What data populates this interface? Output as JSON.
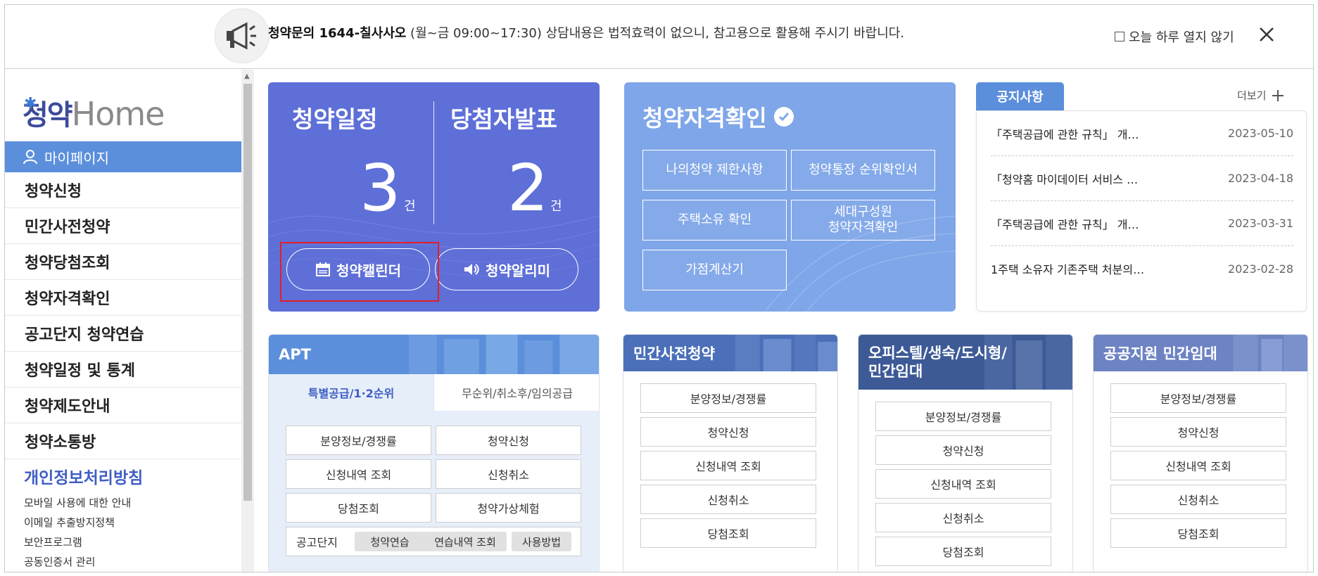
{
  "notice_bar": {
    "inquiry_bold": "청약문의 1644-칠사사오",
    "hours": " (월~금 09:00~17:30)",
    "message": " 상담내용은 법적효력이 없으니, 참고용으로 활용해 주시기 바랍니다.",
    "dont_show_today": "오늘 하루 열지 않기"
  },
  "sidebar": {
    "logo_korean": "청약",
    "logo_english": "Home",
    "mypage": "마이페이지",
    "menu": [
      "청약신청",
      "민간사전청약",
      "청약당첨조회",
      "청약자격확인",
      "공고단지 청약연습",
      "청약일정 및 통계",
      "청약제도안내",
      "청약소통방"
    ],
    "privacy": "개인정보처리방침",
    "links": [
      "모바일 사용에 대한 안내",
      "이메일 추출방지정책",
      "보안프로그램",
      "공동인증서 관리"
    ]
  },
  "schedule": {
    "title_schedule": "청약일정",
    "title_winner": "당첨자발표",
    "count_schedule": "3",
    "count_winner": "2",
    "unit": "건",
    "calendar_button": "청약캘린더",
    "alarm_button": "청약알리미"
  },
  "qualification": {
    "title": "청약자격확인",
    "buttons": [
      "나의청약 제한사항",
      "청약통장 순위확인서",
      "주택소유 확인",
      "세대구성원\n청약자격확인",
      "가점계산기"
    ]
  },
  "notices": {
    "tab": "공지사항",
    "more": "더보기",
    "items": [
      {
        "title": "「주택공급에 관한 규칙」 개…",
        "date": "2023-05-10"
      },
      {
        "title": "「청약홈 마이데이터 서비스 …",
        "date": "2023-04-18"
      },
      {
        "title": "「주택공급에 관한 규칙」 개…",
        "date": "2023-03-31"
      },
      {
        "title": "1주택 소유자 기존주택 처분의…",
        "date": "2023-02-28"
      }
    ]
  },
  "apt": {
    "title": "APT",
    "tab_active": "특별공급/1·2순위",
    "tab_inactive": "무순위/취소후/임의공급",
    "buttons": [
      "분양정보/경쟁률",
      "청약신청",
      "신청내역 조회",
      "신청취소",
      "당첨조회",
      "청약가상체험"
    ],
    "complex_label": "공고단지",
    "chips": [
      "청약연습",
      "연습내역 조회",
      "사용방법"
    ]
  },
  "private_pre": {
    "title": "민간사전청약",
    "buttons": [
      "분양정보/경쟁률",
      "청약신청",
      "신청내역 조회",
      "신청취소",
      "당첨조회"
    ]
  },
  "officetel": {
    "title_line1": "오피스텔/생숙/도시형/",
    "title_line2": "민간임대",
    "buttons": [
      "분양정보/경쟁률",
      "청약신청",
      "신청내역 조회",
      "신청취소",
      "당첨조회"
    ]
  },
  "public_rental": {
    "title": "공공지원 민간임대",
    "buttons": [
      "분양정보/경쟁률",
      "청약신청",
      "신청내역 조회",
      "신청취소",
      "당첨조회"
    ]
  },
  "colors": {
    "schedule_panel": "#5e6fd8",
    "qualification_panel": "#7fa6e8",
    "accent_blue": "#5b8fdc",
    "highlight_red": "#e31e24",
    "privacy_link": "#3f5ec4"
  }
}
